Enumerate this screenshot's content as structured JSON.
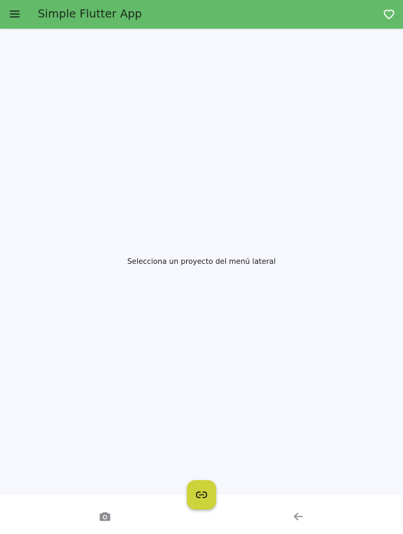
{
  "app_bar": {
    "title": "Simple Flutter App",
    "background_color": "#63bb69",
    "leading_icon": "menu-icon",
    "trailing_icon": "favorite-outline-icon"
  },
  "body": {
    "message": "Selecciona un proyecto del menú lateral",
    "background_color": "#f7f8fd"
  },
  "fab": {
    "icon": "link-icon",
    "color": "#cdd43b"
  },
  "bottom_nav": {
    "background_color": "#ffffff",
    "items": [
      {
        "icon": "camera-icon"
      },
      {
        "icon": "arrow-back-icon"
      }
    ]
  }
}
